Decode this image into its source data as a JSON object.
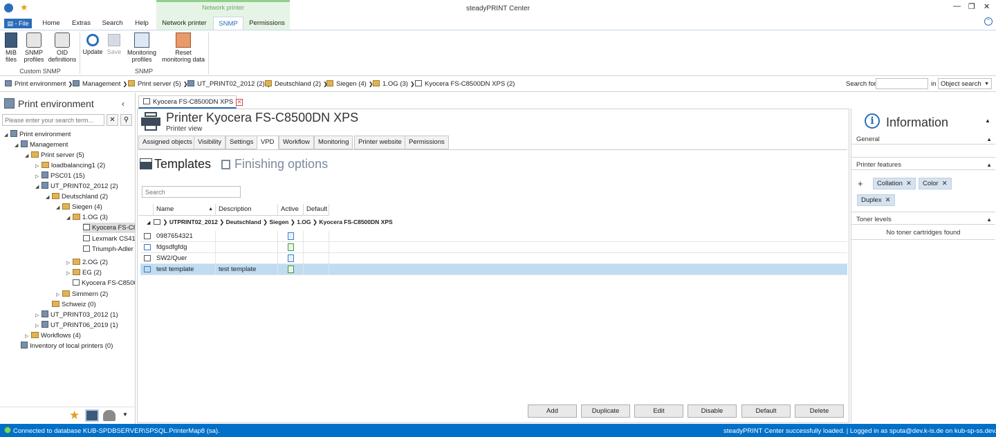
{
  "window": {
    "title": "steadyPRINT Center"
  },
  "ribbon_tabs": {
    "file": "File",
    "home": "Home",
    "extras": "Extras",
    "search": "Search",
    "help": "Help",
    "context_group": "Network printer",
    "network_printer": "Network printer",
    "snmp": "SNMP",
    "permissions": "Permissions"
  },
  "ribbon": {
    "mib_files": "MIB files",
    "snmp_profiles": "SNMP profiles",
    "oid_definitions": "OID definitions",
    "custom_snmp_group": "Custom SNMP",
    "update": "Update",
    "save": "Save",
    "monitoring_profiles": "Monitoring profiles",
    "reset_monitoring": "Reset monitoring data",
    "snmp_group": "SNMP"
  },
  "breadcrumb": [
    "Print environment",
    "Management",
    "Print server (5)",
    "UT_PRINT02_2012 (2)",
    "Deutschland (2)",
    "Siegen (4)",
    "1.OG (3)",
    "Kyocera FS-C8500DN XPS (2)"
  ],
  "search": {
    "label": "Search for",
    "in_label": "in",
    "scope": "Object search"
  },
  "left_panel": {
    "title": "Print environment",
    "search_placeholder": "Please enter your search term...",
    "tree": [
      "Print environment",
      "Management",
      "Print server (5)",
      "loadbalancing1 (2)",
      "PSC01 (15)",
      "UT_PRINT02_2012 (2)",
      "Deutschland (2)",
      "Siegen (4)",
      "1.OG (3)",
      "Kyocera FS-C8",
      "Lexmark CS41(",
      "Triumph-Adler",
      "2.OG (2)",
      "EG (2)",
      "Kyocera FS-C8500",
      "Simmern (2)",
      "Schweiz (0)",
      "UT_PRINT03_2012 (1)",
      "UT_PRINT06_2019 (1)",
      "Workflows (4)",
      "Inventory of local printers (0)"
    ]
  },
  "doc_tab": {
    "label": "Kyocera FS-C8500DN XPS"
  },
  "printer": {
    "title": "Printer Kyocera FS-C8500DN XPS",
    "subtitle": "Printer view"
  },
  "view_tabs": [
    "Assigned objects",
    "Visibility",
    "Settings",
    "VPD",
    "Workflow",
    "Monitoring",
    "Printer website",
    "Permissions"
  ],
  "vpd": {
    "templates_heading": "Templates",
    "finishing_heading": "Finishing options",
    "search_placeholder": "Search",
    "columns": [
      "Name",
      "Description",
      "Active",
      "Default"
    ],
    "group_path": "UTPRINT02_2012 ❯ Deutschland ❯ Siegen ❯ 1.OG ❯ Kyocera FS-C8500DN XPS",
    "rows": [
      {
        "name": "0987654321",
        "description": "",
        "active": "blue"
      },
      {
        "name": "fdgsdfgfdg",
        "description": "",
        "active": "green"
      },
      {
        "name": "SW2/Quer",
        "description": "",
        "active": "blue"
      },
      {
        "name": "test template",
        "description": "test template",
        "active": "green"
      }
    ],
    "buttons": {
      "add": "Add",
      "duplicate": "Duplicate",
      "edit": "Edit",
      "disable": "Disable",
      "default": "Default",
      "delete": "Delete"
    }
  },
  "info_panel": {
    "title": "Information",
    "general": "General",
    "printer_features": "Printer features",
    "features": [
      "Collation",
      "Color",
      "Duplex"
    ],
    "toner_levels": "Toner levels",
    "no_toner": "No toner cartridges found"
  },
  "status": {
    "left": "Connected to database KUB-SPDBSERVER\\SPSQL.PrinterMap8 (sa).",
    "right": "steadyPRINT Center successfully loaded. | Logged in as sputa@dev.k-is.de on kub-sp-ss.dev.k-is.de"
  },
  "colors": {
    "accent": "#2a6db8",
    "status_bar": "#0070c9",
    "selection": "#c0dcf3",
    "context_tab": "#e6f4e6"
  }
}
